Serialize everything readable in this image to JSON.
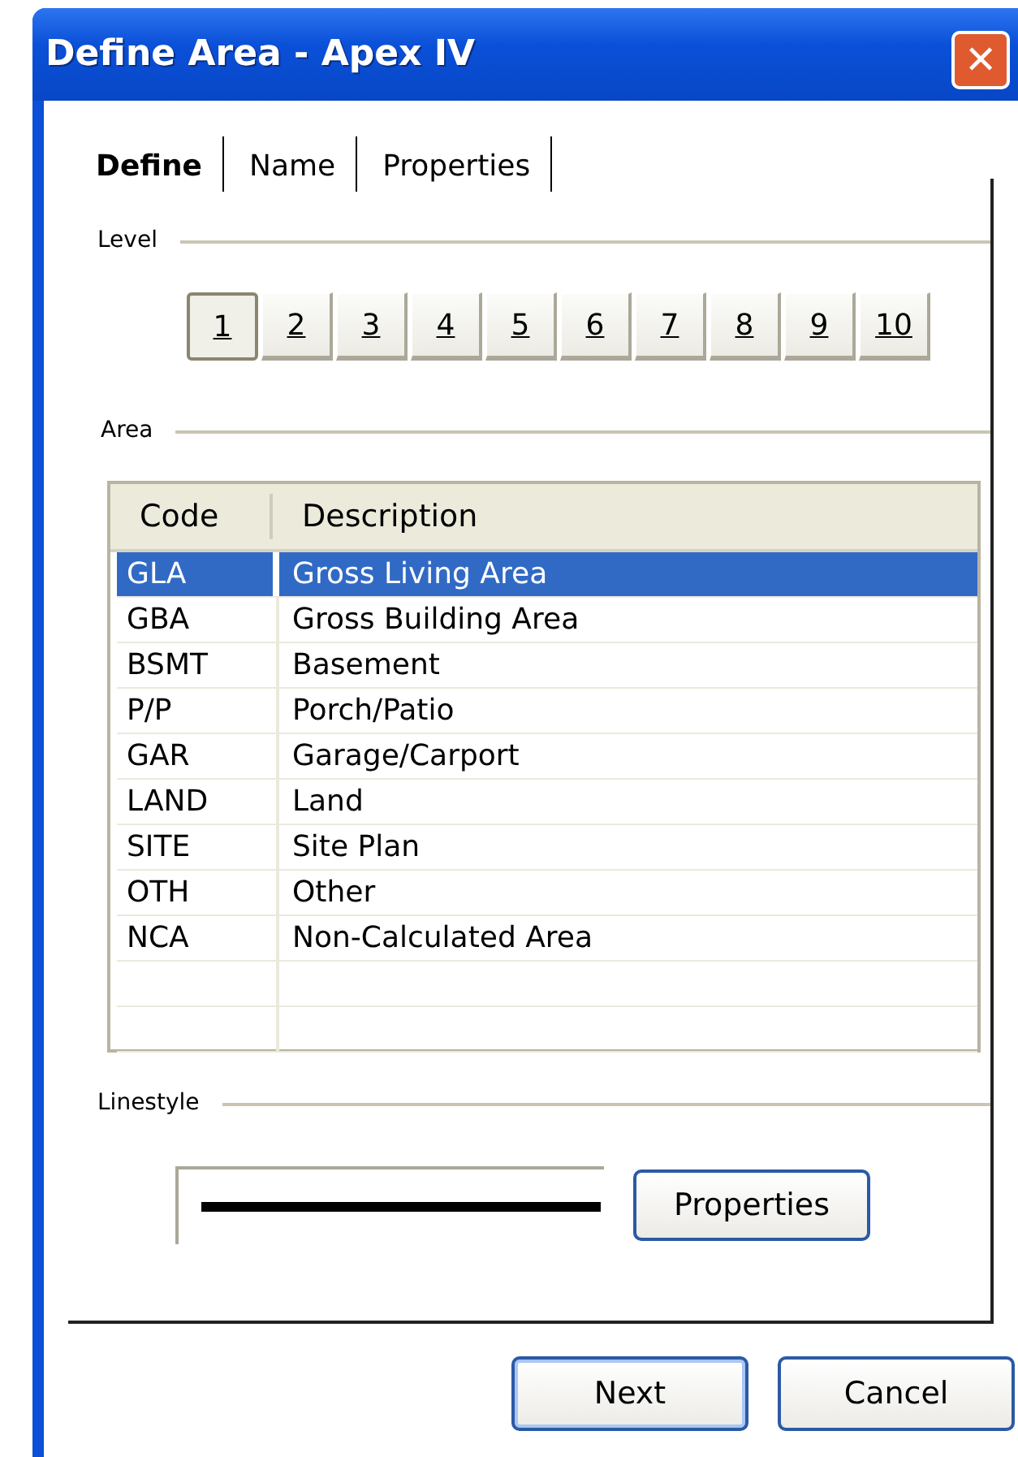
{
  "window": {
    "title": "Define Area - Apex IV",
    "close": "✕"
  },
  "tabs": [
    {
      "label": "Define",
      "selected": true
    },
    {
      "label": "Name",
      "selected": false
    },
    {
      "label": "Properties",
      "selected": false
    }
  ],
  "level": {
    "label": "Level",
    "buttons": [
      {
        "label": "1",
        "selected": true
      },
      {
        "label": "2",
        "selected": false
      },
      {
        "label": "3",
        "selected": false
      },
      {
        "label": "4",
        "selected": false
      },
      {
        "label": "5",
        "selected": false
      },
      {
        "label": "6",
        "selected": false
      },
      {
        "label": "7",
        "selected": false
      },
      {
        "label": "8",
        "selected": false
      },
      {
        "label": "9",
        "selected": false
      },
      {
        "label": "10",
        "selected": false
      }
    ]
  },
  "area": {
    "label": "Area",
    "table": {
      "columns": [
        "Code",
        "Description"
      ],
      "rows": [
        {
          "cells": [
            "GLA",
            "Gross Living Area"
          ],
          "selected": true
        },
        {
          "cells": [
            "GBA",
            "Gross Building Area"
          ],
          "selected": false
        },
        {
          "cells": [
            "BSMT",
            "Basement"
          ],
          "selected": false
        },
        {
          "cells": [
            "P/P",
            "Porch/Patio"
          ],
          "selected": false
        },
        {
          "cells": [
            "GAR",
            "Garage/Carport"
          ],
          "selected": false
        },
        {
          "cells": [
            "LAND",
            "Land"
          ],
          "selected": false
        },
        {
          "cells": [
            "SITE",
            "Site Plan"
          ],
          "selected": false
        },
        {
          "cells": [
            "OTH",
            "Other"
          ],
          "selected": false
        },
        {
          "cells": [
            "NCA",
            "Non-Calculated Area"
          ],
          "selected": false
        }
      ]
    }
  },
  "linestyle": {
    "label": "Linestyle",
    "button": "Properties"
  },
  "buttons": [
    {
      "label": "Next",
      "default": true
    },
    {
      "label": "Cancel",
      "default": false
    }
  ]
}
